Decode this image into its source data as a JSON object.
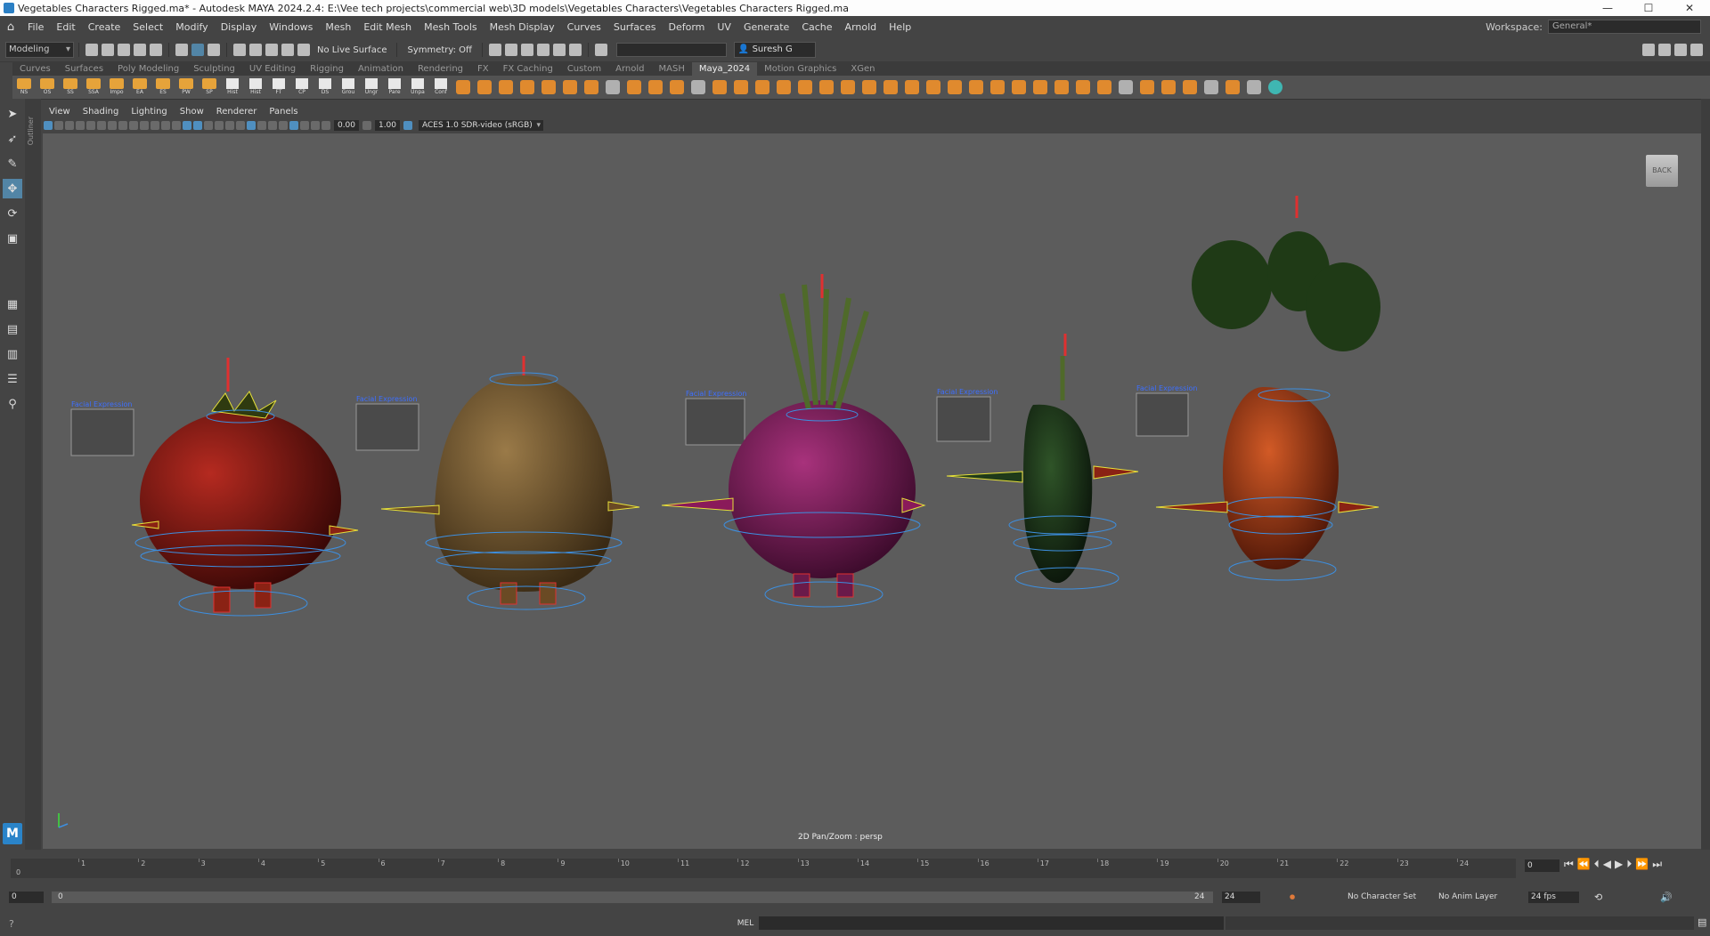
{
  "window": {
    "title": "Vegetables Characters Rigged.ma* - Autodesk MAYA 2024.2.4: E:\\Vee tech projects\\commercial web\\3D models\\Vegetables Characters\\Vegetables Characters Rigged.ma",
    "controls": [
      "—",
      "☐",
      "✕"
    ]
  },
  "menu": {
    "items": [
      "File",
      "Edit",
      "Create",
      "Select",
      "Modify",
      "Display",
      "Windows",
      "Mesh",
      "Edit Mesh",
      "Mesh Tools",
      "Mesh Display",
      "Curves",
      "Surfaces",
      "Deform",
      "UV",
      "Generate",
      "Cache",
      "Arnold",
      "Help"
    ],
    "workspace_label": "Workspace:",
    "workspace_value": "General*"
  },
  "status": {
    "mode": "Modeling",
    "live_surface": "No Live Surface",
    "symmetry": "Symmetry: Off",
    "user": "Suresh G"
  },
  "shelf": {
    "tabs": [
      "Curves",
      "Surfaces",
      "Poly Modeling",
      "Sculpting",
      "UV Editing",
      "Rigging",
      "Animation",
      "Rendering",
      "FX",
      "FX Caching",
      "Custom",
      "Arnold",
      "MASH",
      "Maya_2024",
      "Motion Graphics",
      "XGen"
    ],
    "active_tab": "Maya_2024",
    "folder_buttons": [
      "NS",
      "OS",
      "SS",
      "SSA",
      "Impo",
      "EA",
      "ES",
      "PW",
      "SP"
    ],
    "doc_buttons": [
      "Hist",
      "Hist",
      "FT",
      "CP",
      "DS",
      "Grou",
      "Ungr",
      "Pare",
      "Unpa",
      "Conf"
    ]
  },
  "panel": {
    "menus": [
      "View",
      "Shading",
      "Lighting",
      "Show",
      "Renderer",
      "Panels"
    ],
    "exposure": "0.00",
    "gamma": "1.00",
    "colorspace": "ACES 1.0 SDR-video (sRGB)"
  },
  "viewport": {
    "view_cube": "BACK",
    "status_label": "2D Pan/Zoom : persp",
    "characters": [
      {
        "name": "tomato",
        "panel_label": "Facial Expression"
      },
      {
        "name": "potato",
        "panel_label": "Facial Expression"
      },
      {
        "name": "onion",
        "panel_label": "Facial Expression"
      },
      {
        "name": "pepper",
        "panel_label": "Facial Expression"
      },
      {
        "name": "carrot",
        "panel_label": "Facial Expression"
      }
    ],
    "colors": {
      "tomato": "#8e1c14",
      "potato": "#7a5a30",
      "onion": "#7a1f5c",
      "pepper": "#1f3a1a",
      "carrot": "#b2401a",
      "rig_blue": "#3d8fe0",
      "rig_red": "#e03030",
      "rig_yellow": "#e6e03a",
      "rig_green": "#3ce03c"
    }
  },
  "timeline": {
    "start_label": "0",
    "frames": [
      "1",
      "2",
      "3",
      "4",
      "5",
      "6",
      "7",
      "8",
      "9",
      "10",
      "11",
      "12",
      "13",
      "14",
      "15",
      "16",
      "17",
      "18",
      "19",
      "20",
      "21",
      "22",
      "23",
      "24"
    ],
    "current_frame": "0"
  },
  "range": {
    "start": "0",
    "inner_start": "0",
    "inner_end": "24",
    "end": "24",
    "character_set": "No Character Set",
    "anim_layer": "No Anim Layer",
    "fps": "24 fps"
  },
  "command": {
    "mel": "MEL"
  }
}
